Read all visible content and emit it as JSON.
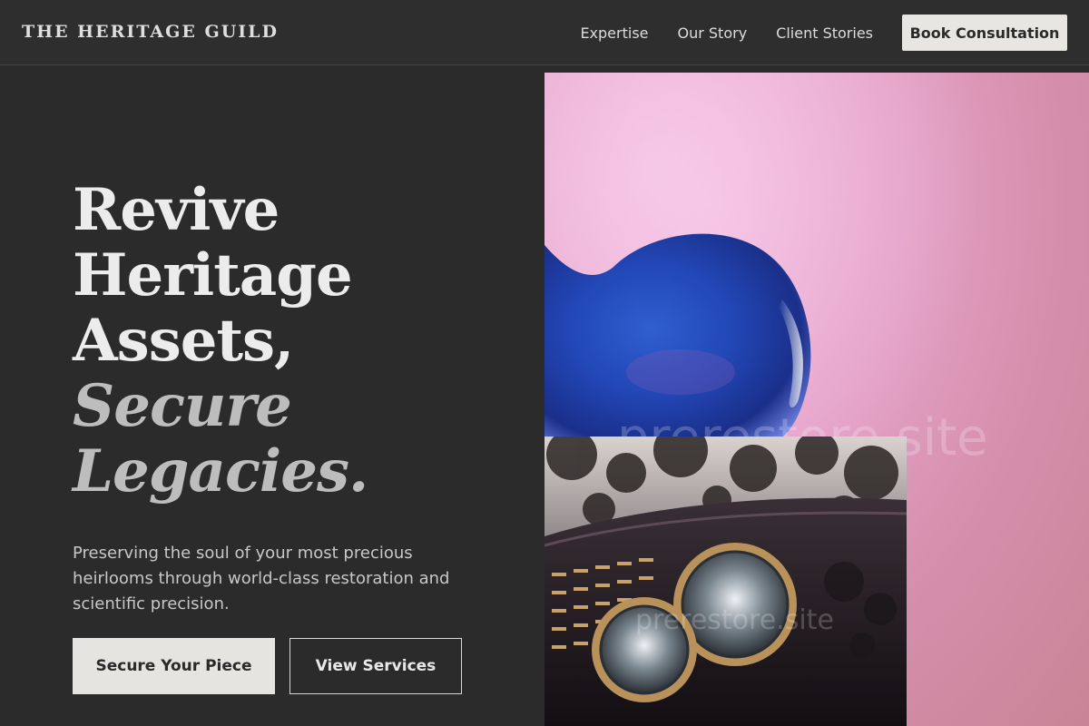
{
  "brand": {
    "name": "THE HERITAGE GUILD"
  },
  "nav": {
    "links": [
      "Expertise",
      "Our Story",
      "Client Stories"
    ],
    "cta": "Book Consultation"
  },
  "hero": {
    "headline_lines": [
      "Revive",
      "Heritage",
      "Assets,"
    ],
    "headline_italic_lines": [
      "Secure",
      "Legacies."
    ],
    "subtitle": "Preserving the soul of your most precious heirlooms through world-class restoration and scientific precision.",
    "primary_button": "Secure Your Piece",
    "secondary_button": "View Services"
  },
  "images": {
    "large_watermark": "prerestore.site",
    "small_watermark": "prerestore.site"
  },
  "colors": {
    "background": "#2b2b2b",
    "accent_light": "#e8e6e3",
    "text_primary": "#ececec",
    "text_secondary": "#c8c8c8"
  }
}
